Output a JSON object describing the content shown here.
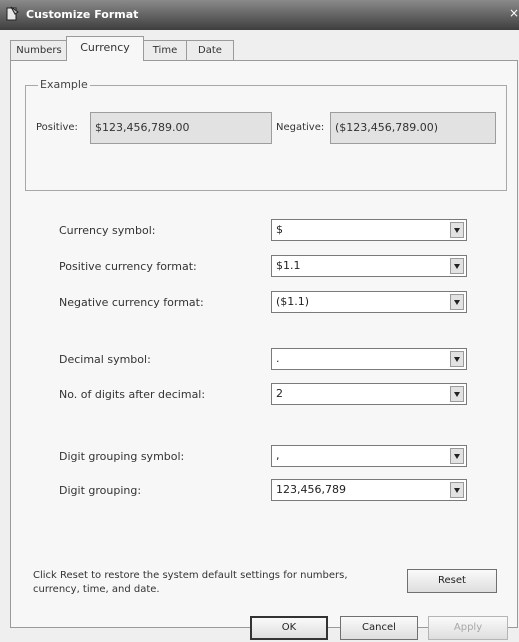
{
  "window": {
    "title": "Customize Format",
    "close_glyph": "×"
  },
  "tabs": [
    {
      "label": "Numbers",
      "active": false
    },
    {
      "label": "Currency",
      "active": true
    },
    {
      "label": "Time",
      "active": false
    },
    {
      "label": "Date",
      "active": false
    }
  ],
  "example": {
    "group_label": "Example",
    "positive_label": "Positive:",
    "positive_value": "$123,456,789.00",
    "negative_label": "Negative:",
    "negative_value": "($123,456,789.00)"
  },
  "settings": [
    {
      "label": "Currency symbol:",
      "value": "$"
    },
    {
      "label": "Positive currency format:",
      "value": "$1.1"
    },
    {
      "label": "Negative currency format:",
      "value": "($1.1)"
    },
    {
      "label": "Decimal symbol:",
      "value": "."
    },
    {
      "label": "No. of digits after decimal:",
      "value": "2"
    },
    {
      "label": "Digit grouping symbol:",
      "value": ","
    },
    {
      "label": "Digit grouping:",
      "value": "123,456,789"
    }
  ],
  "reset": {
    "text": "Click Reset to restore the system default settings for numbers, currency, time, and date.",
    "button_label": "Reset"
  },
  "footer": {
    "ok_label": "OK",
    "cancel_label": "Cancel",
    "apply_label": "Apply"
  },
  "icons": {
    "title": "app-icon",
    "dropdown": "chevron-down-icon",
    "close": "close-icon"
  }
}
